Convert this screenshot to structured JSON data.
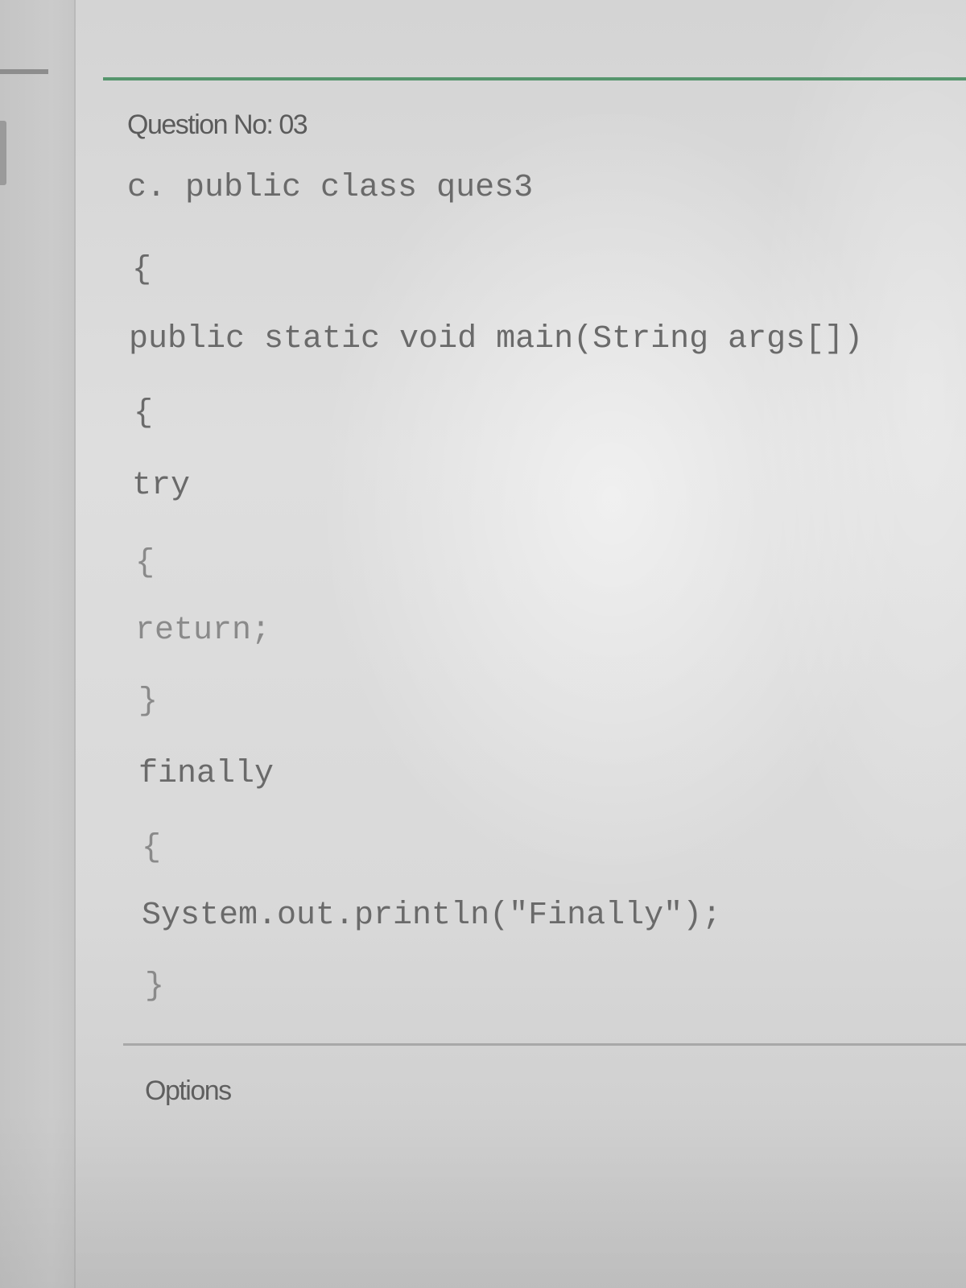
{
  "question": {
    "number_label": "Question No: 03"
  },
  "code_lines": [
    "c. public class ques3",
    "{",
    "public static void main(String args[])",
    "{",
    "try",
    "{",
    "return;",
    "}",
    "finally",
    "{",
    "System.out.println(\"Finally\");",
    "}"
  ],
  "options": {
    "label": "Options"
  },
  "colors": {
    "accent_rule": "#3f8a5a"
  }
}
